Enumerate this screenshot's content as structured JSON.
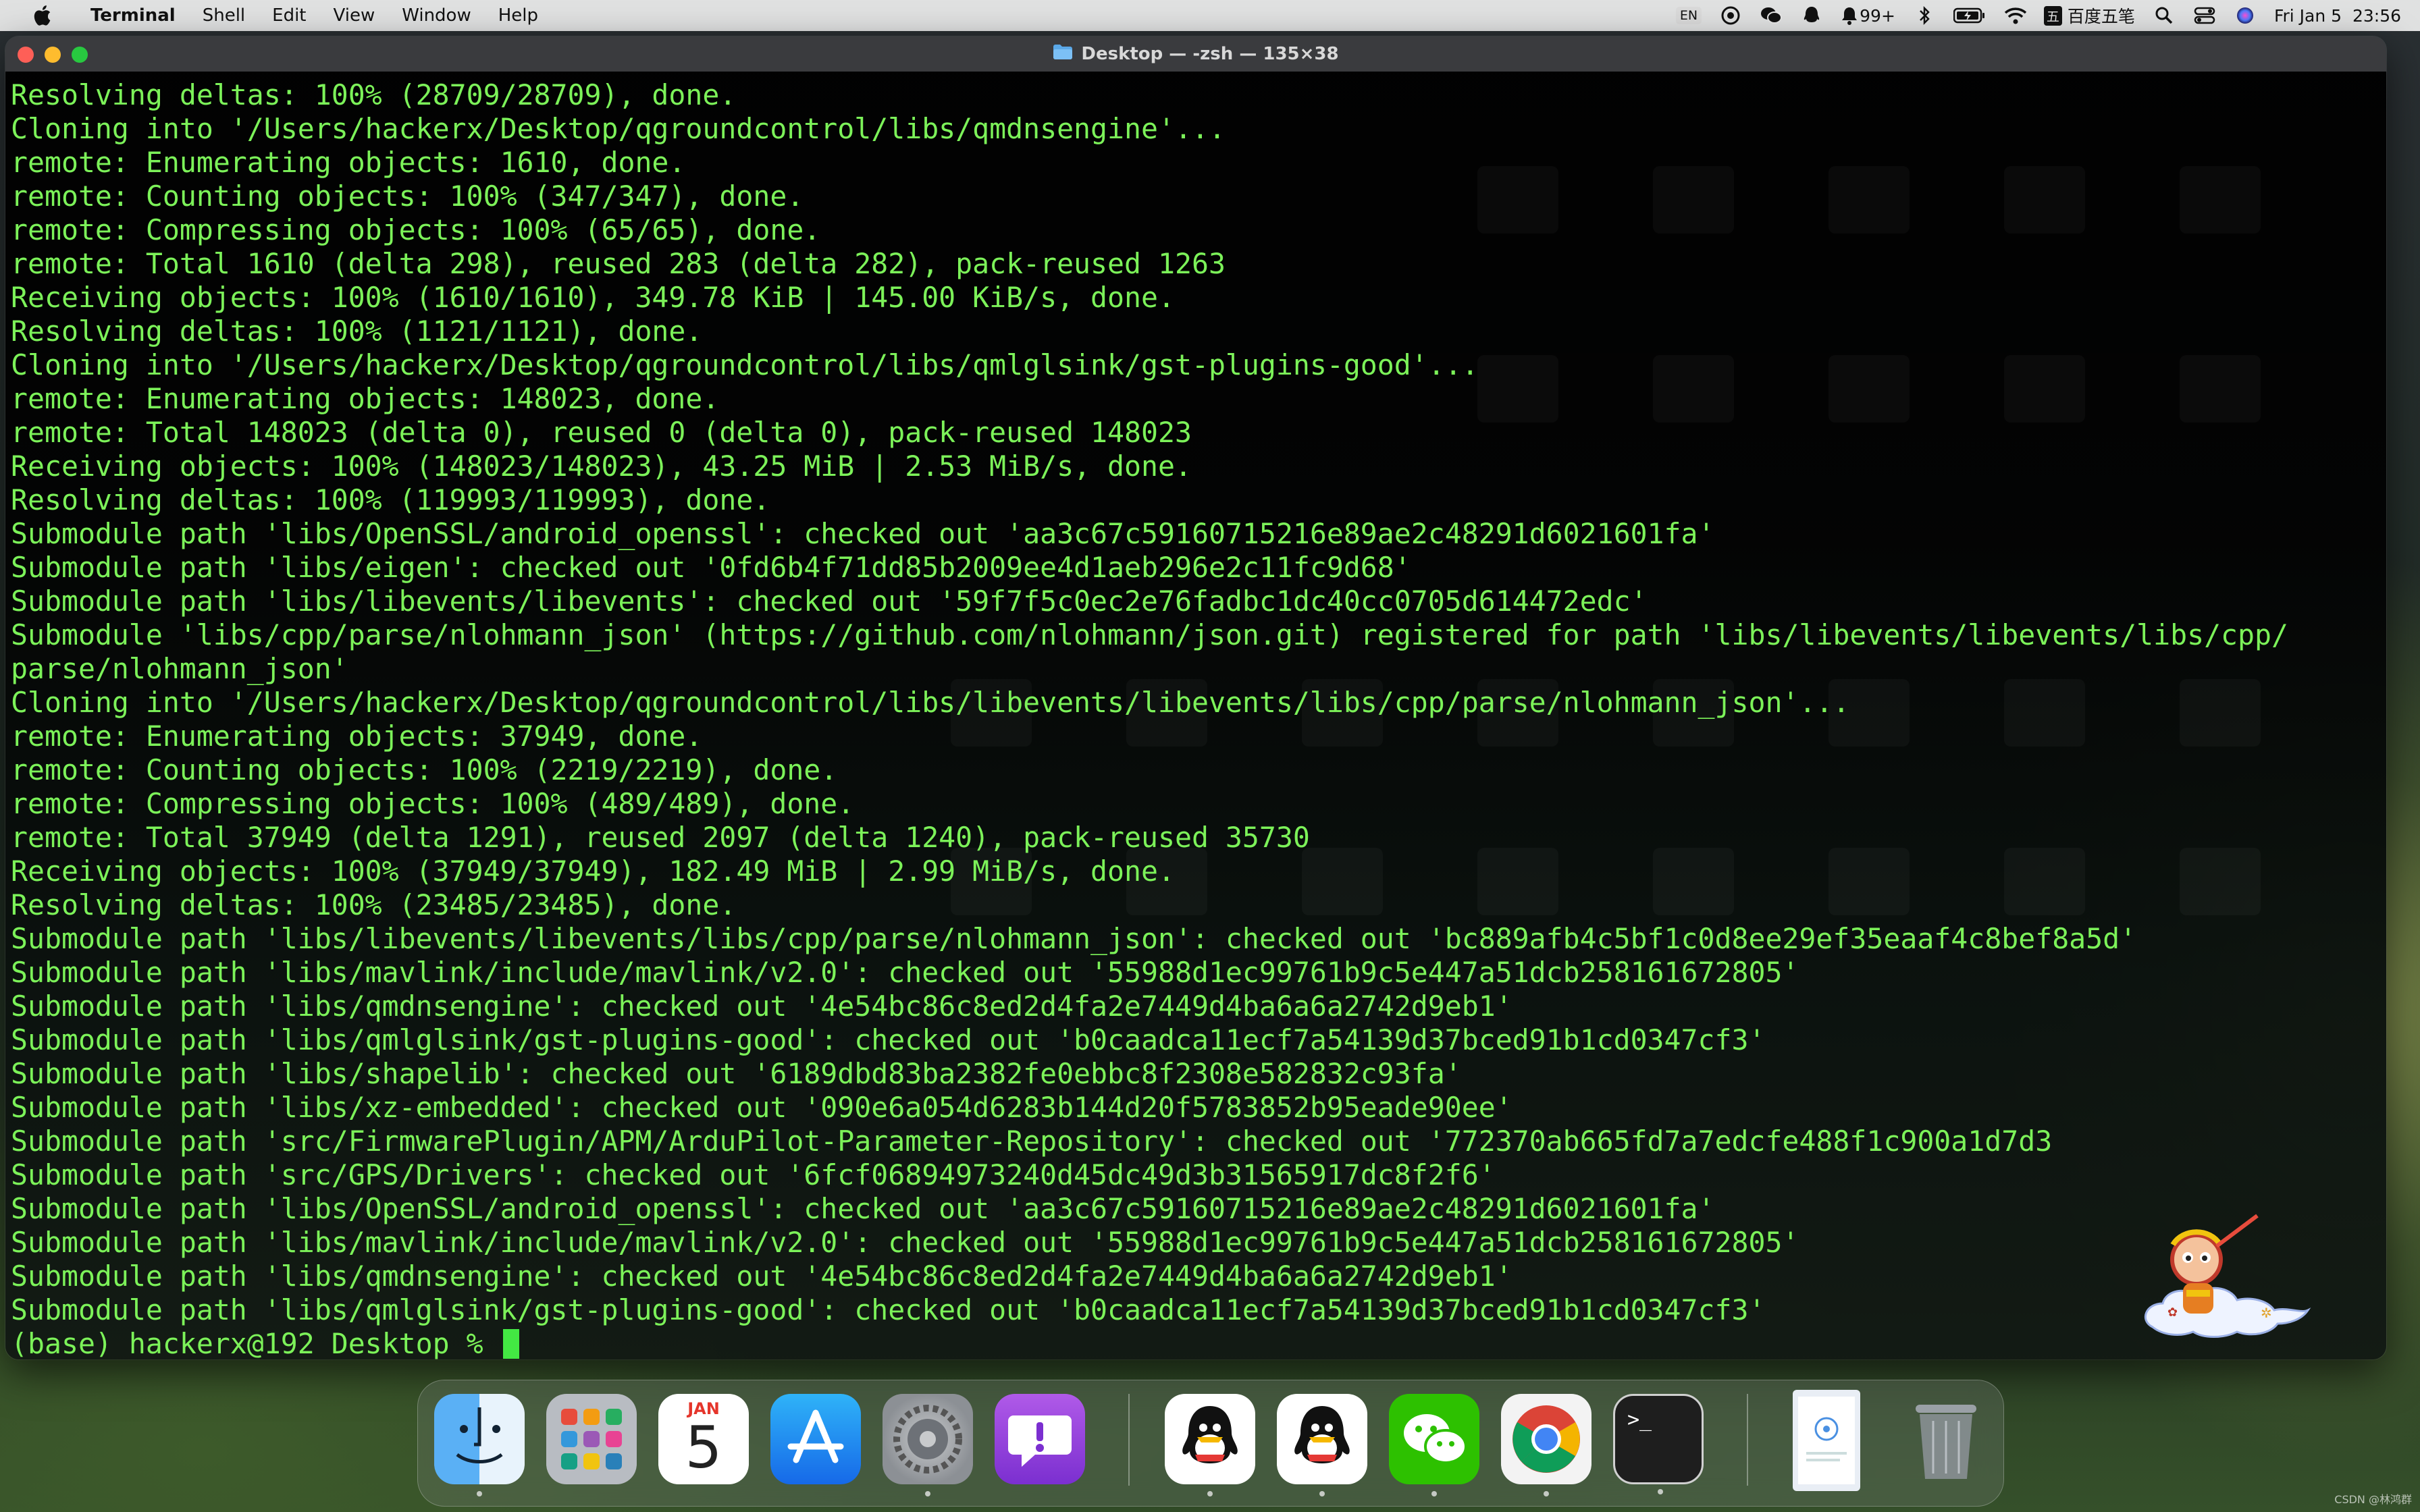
{
  "menubar": {
    "app_name": "Terminal",
    "items": [
      "Shell",
      "Edit",
      "View",
      "Window",
      "Help"
    ],
    "input_method": "EN",
    "notification_count": "99+",
    "ime_label": "百度五笔",
    "ime_badge": "五",
    "datetime": "Fri Jan 5  23:56"
  },
  "window": {
    "title": "Desktop — -zsh — 135×38"
  },
  "terminal": {
    "lines": [
      "Resolving deltas: 100% (28709/28709), done.",
      "Cloning into '/Users/hackerx/Desktop/qgroundcontrol/libs/qmdnsengine'...",
      "remote: Enumerating objects: 1610, done.",
      "remote: Counting objects: 100% (347/347), done.",
      "remote: Compressing objects: 100% (65/65), done.",
      "remote: Total 1610 (delta 298), reused 283 (delta 282), pack-reused 1263",
      "Receiving objects: 100% (1610/1610), 349.78 KiB | 145.00 KiB/s, done.",
      "Resolving deltas: 100% (1121/1121), done.",
      "Cloning into '/Users/hackerx/Desktop/qgroundcontrol/libs/qmlglsink/gst-plugins-good'...",
      "remote: Enumerating objects: 148023, done.",
      "remote: Total 148023 (delta 0), reused 0 (delta 0), pack-reused 148023",
      "Receiving objects: 100% (148023/148023), 43.25 MiB | 2.53 MiB/s, done.",
      "Resolving deltas: 100% (119993/119993), done.",
      "Submodule path 'libs/OpenSSL/android_openssl': checked out 'aa3c67c59160715216e89ae2c48291d6021601fa'",
      "Submodule path 'libs/eigen': checked out '0fd6b4f71dd85b2009ee4d1aeb296e2c11fc9d68'",
      "Submodule path 'libs/libevents/libevents': checked out '59f7f5c0ec2e76fadbc1dc40cc0705d614472edc'",
      "Submodule 'libs/cpp/parse/nlohmann_json' (https://github.com/nlohmann/json.git) registered for path 'libs/libevents/libevents/libs/cpp/",
      "parse/nlohmann_json'",
      "Cloning into '/Users/hackerx/Desktop/qgroundcontrol/libs/libevents/libevents/libs/cpp/parse/nlohmann_json'...",
      "remote: Enumerating objects: 37949, done.",
      "remote: Counting objects: 100% (2219/2219), done.",
      "remote: Compressing objects: 100% (489/489), done.",
      "remote: Total 37949 (delta 1291), reused 2097 (delta 1240), pack-reused 35730",
      "Receiving objects: 100% (37949/37949), 182.49 MiB | 2.99 MiB/s, done.",
      "Resolving deltas: 100% (23485/23485), done.",
      "Submodule path 'libs/libevents/libevents/libs/cpp/parse/nlohmann_json': checked out 'bc889afb4c5bf1c0d8ee29ef35eaaf4c8bef8a5d'",
      "Submodule path 'libs/mavlink/include/mavlink/v2.0': checked out '55988d1ec99761b9c5e447a51dcb258161672805'",
      "Submodule path 'libs/qmdnsengine': checked out '4e54bc86c8ed2d4fa2e7449d4ba6a6a2742d9eb1'",
      "Submodule path 'libs/qmlglsink/gst-plugins-good': checked out 'b0caadca11ecf7a54139d37bced91b1cd0347cf3'",
      "Submodule path 'libs/shapelib': checked out '6189dbd83ba2382fe0ebbc8f2308e582832c93fa'",
      "Submodule path 'libs/xz-embedded': checked out '090e6a054d6283b144d20f5783852b95eade90ee'",
      "Submodule path 'src/FirmwarePlugin/APM/ArduPilot-Parameter-Repository': checked out '772370ab665fd7a7edcfe488f1c900a1d7d3",
      "Submodule path 'src/GPS/Drivers': checked out '6fcf06894973240d45dc49d3b31565917dc8f2f6'",
      "Submodule path 'libs/OpenSSL/android_openssl': checked out 'aa3c67c59160715216e89ae2c48291d6021601fa'",
      "Submodule path 'libs/mavlink/include/mavlink/v2.0': checked out '55988d1ec99761b9c5e447a51dcb258161672805'",
      "Submodule path 'libs/qmdnsengine': checked out '4e54bc86c8ed2d4fa2e7449d4ba6a6a2742d9eb1'",
      "Submodule path 'libs/qmlglsink/gst-plugins-good': checked out 'b0caadca11ecf7a54139d37bced91b1cd0347cf3'"
    ],
    "prompt": "(base) hackerx@192 Desktop % "
  },
  "dock": {
    "calendar_month": "JAN",
    "calendar_day": "5",
    "terminal_glyph": ">_",
    "items": [
      "finder-icon",
      "launchpad-icon",
      "calendar-icon",
      "app-store-icon",
      "system-settings-icon",
      "feedback-icon",
      "qq-icon",
      "qq-icon",
      "wechat-icon",
      "chrome-icon",
      "terminal-icon",
      "document-thumbnail",
      "trash-icon"
    ]
  },
  "watermark": "CSDN @林鸿群",
  "colors": {
    "terminal_text": "#7cf259",
    "cursor": "#43e843",
    "menubar_bg": "#e8e8e8"
  }
}
